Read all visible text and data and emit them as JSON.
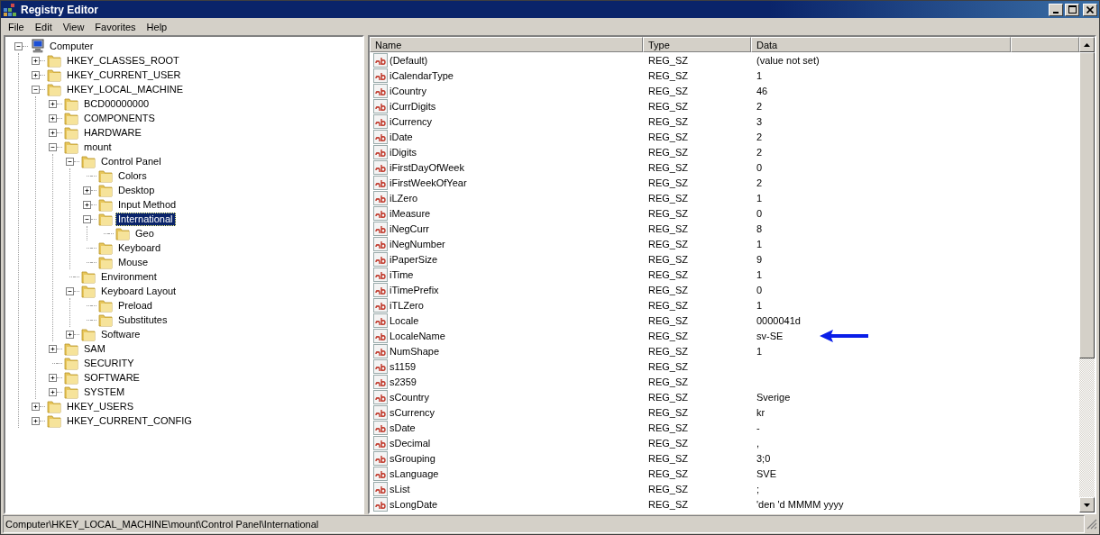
{
  "window": {
    "title": "Registry Editor"
  },
  "menu": [
    "File",
    "Edit",
    "View",
    "Favorites",
    "Help"
  ],
  "tree": [
    {
      "label": "Computer",
      "kind": "computer",
      "expanded": true,
      "selected": false,
      "children": [
        {
          "label": "HKEY_CLASSES_ROOT",
          "kind": "folder",
          "expanded": false,
          "selected": false
        },
        {
          "label": "HKEY_CURRENT_USER",
          "kind": "folder",
          "expanded": false,
          "selected": false
        },
        {
          "label": "HKEY_LOCAL_MACHINE",
          "kind": "folder",
          "expanded": true,
          "selected": false,
          "children": [
            {
              "label": "BCD00000000",
              "kind": "folder",
              "expanded": false,
              "selected": false
            },
            {
              "label": "COMPONENTS",
              "kind": "folder",
              "expanded": false,
              "selected": false
            },
            {
              "label": "HARDWARE",
              "kind": "folder",
              "expanded": false,
              "selected": false
            },
            {
              "label": "mount",
              "kind": "folder",
              "expanded": true,
              "selected": false,
              "children": [
                {
                  "label": "Control Panel",
                  "kind": "folder",
                  "expanded": true,
                  "selected": false,
                  "children": [
                    {
                      "label": "Colors",
                      "kind": "folder",
                      "selected": false
                    },
                    {
                      "label": "Desktop",
                      "kind": "folder",
                      "expanded": false,
                      "selected": false
                    },
                    {
                      "label": "Input Method",
                      "kind": "folder",
                      "expanded": false,
                      "selected": false
                    },
                    {
                      "label": "International",
                      "kind": "folder",
                      "expanded": true,
                      "selected": true,
                      "children": [
                        {
                          "label": "Geo",
                          "kind": "folder",
                          "selected": false
                        }
                      ]
                    },
                    {
                      "label": "Keyboard",
                      "kind": "folder",
                      "selected": false
                    },
                    {
                      "label": "Mouse",
                      "kind": "folder",
                      "selected": false
                    }
                  ]
                },
                {
                  "label": "Environment",
                  "kind": "folder",
                  "selected": false
                },
                {
                  "label": "Keyboard Layout",
                  "kind": "folder",
                  "expanded": true,
                  "selected": false,
                  "children": [
                    {
                      "label": "Preload",
                      "kind": "folder",
                      "selected": false
                    },
                    {
                      "label": "Substitutes",
                      "kind": "folder",
                      "selected": false
                    }
                  ]
                },
                {
                  "label": "Software",
                  "kind": "folder",
                  "expanded": false,
                  "selected": false
                }
              ]
            },
            {
              "label": "SAM",
              "kind": "folder",
              "expanded": false,
              "selected": false
            },
            {
              "label": "SECURITY",
              "kind": "folder",
              "selected": false
            },
            {
              "label": "SOFTWARE",
              "kind": "folder",
              "expanded": false,
              "selected": false
            },
            {
              "label": "SYSTEM",
              "kind": "folder",
              "expanded": false,
              "selected": false
            }
          ]
        },
        {
          "label": "HKEY_USERS",
          "kind": "folder",
          "expanded": false,
          "selected": false
        },
        {
          "label": "HKEY_CURRENT_CONFIG",
          "kind": "folder",
          "expanded": false,
          "selected": false
        }
      ]
    }
  ],
  "table": {
    "columns": [
      "Name",
      "Type",
      "Data"
    ],
    "rows": [
      {
        "name": "(Default)",
        "type": "REG_SZ",
        "data": "(value not set)",
        "marked": false
      },
      {
        "name": "iCalendarType",
        "type": "REG_SZ",
        "data": "1",
        "marked": false
      },
      {
        "name": "iCountry",
        "type": "REG_SZ",
        "data": "46",
        "marked": false
      },
      {
        "name": "iCurrDigits",
        "type": "REG_SZ",
        "data": "2",
        "marked": false
      },
      {
        "name": "iCurrency",
        "type": "REG_SZ",
        "data": "3",
        "marked": false
      },
      {
        "name": "iDate",
        "type": "REG_SZ",
        "data": "2",
        "marked": false
      },
      {
        "name": "iDigits",
        "type": "REG_SZ",
        "data": "2",
        "marked": false
      },
      {
        "name": "iFirstDayOfWeek",
        "type": "REG_SZ",
        "data": "0",
        "marked": false
      },
      {
        "name": "iFirstWeekOfYear",
        "type": "REG_SZ",
        "data": "2",
        "marked": false
      },
      {
        "name": "iLZero",
        "type": "REG_SZ",
        "data": "1",
        "marked": false
      },
      {
        "name": "iMeasure",
        "type": "REG_SZ",
        "data": "0",
        "marked": false
      },
      {
        "name": "iNegCurr",
        "type": "REG_SZ",
        "data": "8",
        "marked": false
      },
      {
        "name": "iNegNumber",
        "type": "REG_SZ",
        "data": "1",
        "marked": false
      },
      {
        "name": "iPaperSize",
        "type": "REG_SZ",
        "data": "9",
        "marked": false
      },
      {
        "name": "iTime",
        "type": "REG_SZ",
        "data": "1",
        "marked": false
      },
      {
        "name": "iTimePrefix",
        "type": "REG_SZ",
        "data": "0",
        "marked": false
      },
      {
        "name": "iTLZero",
        "type": "REG_SZ",
        "data": "1",
        "marked": false
      },
      {
        "name": "Locale",
        "type": "REG_SZ",
        "data": "0000041d",
        "marked": false
      },
      {
        "name": "LocaleName",
        "type": "REG_SZ",
        "data": "sv-SE",
        "marked": true
      },
      {
        "name": "NumShape",
        "type": "REG_SZ",
        "data": "1",
        "marked": false
      },
      {
        "name": "s1159",
        "type": "REG_SZ",
        "marked": false
      },
      {
        "name": "s2359",
        "type": "REG_SZ",
        "marked": false
      },
      {
        "name": "sCountry",
        "type": "REG_SZ",
        "data": "Sverige",
        "marked": false
      },
      {
        "name": "sCurrency",
        "type": "REG_SZ",
        "data": "kr",
        "marked": false
      },
      {
        "name": "sDate",
        "type": "REG_SZ",
        "data": "-",
        "marked": false
      },
      {
        "name": "sDecimal",
        "type": "REG_SZ",
        "data": ",",
        "marked": false
      },
      {
        "name": "sGrouping",
        "type": "REG_SZ",
        "data": "3;0",
        "marked": false
      },
      {
        "name": "sLanguage",
        "type": "REG_SZ",
        "data": "SVE",
        "marked": false
      },
      {
        "name": "sList",
        "type": "REG_SZ",
        "data": ";",
        "marked": false
      },
      {
        "name": "sLongDate",
        "type": "REG_SZ",
        "data": "'den 'd MMMM yyyy",
        "marked": false
      }
    ]
  },
  "status_bar": "Computer\\HKEY_LOCAL_MACHINE\\mount\\Control Panel\\International"
}
